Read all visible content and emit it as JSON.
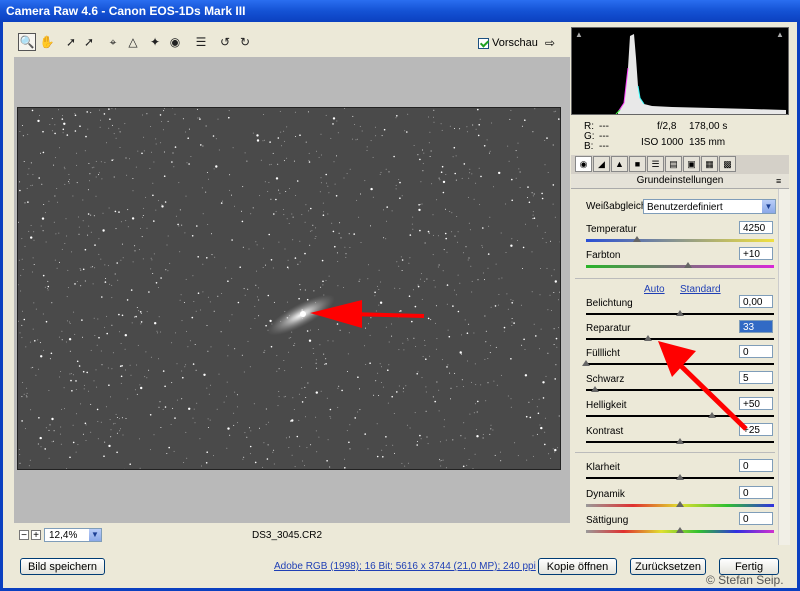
{
  "window": {
    "title": "Camera Raw 4.6 - Canon EOS-1Ds Mark III"
  },
  "toolbar": {
    "tools": [
      "zoom-icon",
      "hand-icon",
      "white-balance-icon",
      "color-sampler-icon",
      "crop-icon",
      "straighten-icon",
      "spot-removal-icon",
      "red-eye-icon",
      "preferences-icon",
      "rotate-left-icon",
      "rotate-right-icon"
    ],
    "preview_label": "Vorschau"
  },
  "status": {
    "zoom": "12,4%",
    "zoom_minus": "−",
    "zoom_plus": "+",
    "filename": "DS3_3045.CR2"
  },
  "info": {
    "r_label": "R:",
    "g_label": "G:",
    "b_label": "B:",
    "r": "---",
    "g": "---",
    "b": "---",
    "aperture": "f/2,8",
    "shutter": "178,00 s",
    "iso": "ISO 1000",
    "focal": "135 mm"
  },
  "panel": {
    "title": "Grundeinstellungen",
    "wb_label": "Weißabgleich:",
    "wb_value": "Benutzerdefiniert",
    "auto": "Auto",
    "standard": "Standard",
    "sliders": [
      {
        "label": "Temperatur",
        "value": "4250",
        "pos": 0.27
      },
      {
        "label": "Farbton",
        "value": "+10",
        "pos": 0.54
      },
      {
        "label": "Belichtung",
        "value": "0,00",
        "pos": 0.5
      },
      {
        "label": "Reparatur",
        "value": "33",
        "pos": 0.33
      },
      {
        "label": "Fülllicht",
        "value": "0",
        "pos": 0.0
      },
      {
        "label": "Schwarz",
        "value": "5",
        "pos": 0.05
      },
      {
        "label": "Helligkeit",
        "value": "+50",
        "pos": 0.67
      },
      {
        "label": "Kontrast",
        "value": "+25",
        "pos": 0.5
      },
      {
        "label": "Klarheit",
        "value": "0",
        "pos": 0.5
      },
      {
        "label": "Dynamik",
        "value": "0",
        "pos": 0.5
      },
      {
        "label": "Sättigung",
        "value": "0",
        "pos": 0.5
      }
    ]
  },
  "footer": {
    "save": "Bild speichern",
    "workflow": "Adobe RGB (1998); 16 Bit; 5616 x 3744 (21,0 MP); 240 ppi",
    "open_copy": "Kopie öffnen",
    "reset": "Zurücksetzen",
    "done": "Fertig",
    "copyright": "© Stefan Seip."
  },
  "colors": {
    "arrow": "#ff0000",
    "title_bar": "#0b40c0",
    "link": "#1f3fb5"
  }
}
